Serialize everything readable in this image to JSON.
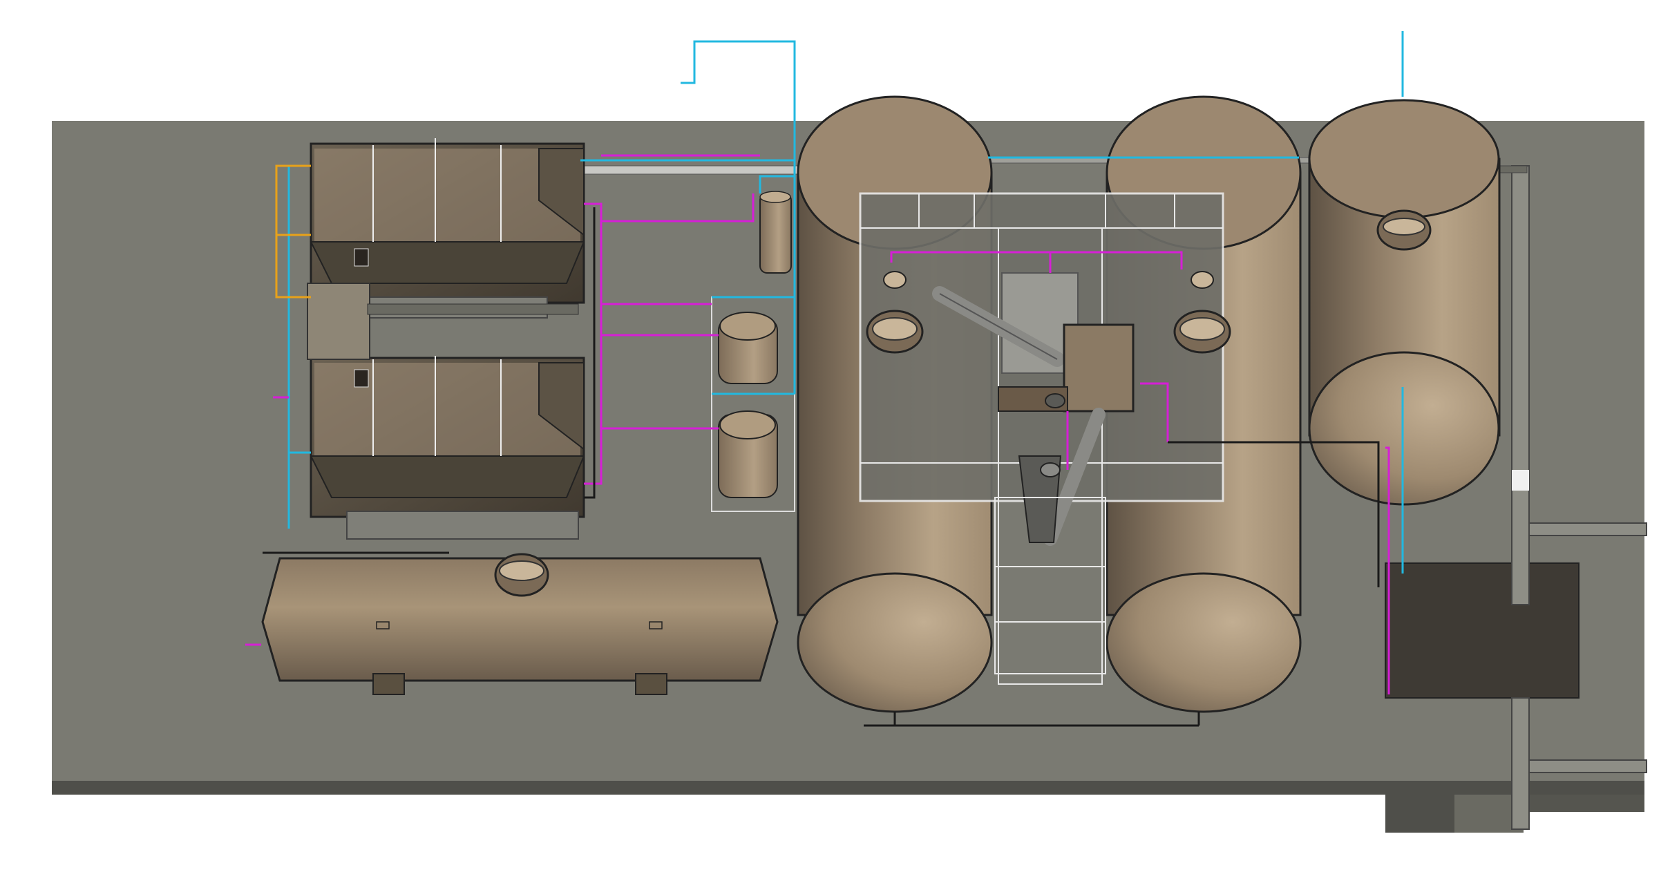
{
  "view": {
    "type": "3D plant layout, top view",
    "labels": []
  },
  "colors": {
    "background": "#ffffff",
    "slab": "#7a7a72",
    "slab_edge": "#4f4f4a",
    "tank_light": "#b8a48a",
    "tank_dark": "#6e6050",
    "basin_dark": "#4a4438",
    "basin_floor": "#a08e78",
    "pipe_water": "#22b8e0",
    "pipe_chem": "#d61fd6",
    "pipe_gas": "#e8a21a",
    "pipe_black": "#1a1a1a",
    "steel_white": "#e8e8e8",
    "equipment_grey": "#8a8a86",
    "dark_pit": "#3e3a34"
  },
  "components": {
    "concrete_slab": "concrete-slab",
    "process_basins": [
      "basin-upper",
      "basin-lower"
    ],
    "horizontal_tank": "horizontal-storage-tank",
    "dosing_tanks": [
      "dosing-tank-1",
      "dosing-tank-2",
      "dosing-tank-3"
    ],
    "vertical_tanks": [
      "vertical-tank-1",
      "vertical-tank-2",
      "vertical-tank-3"
    ],
    "central_platform": "central-access-platform",
    "screw_conveyor": "screw-conveyor",
    "sump": "sump-pit"
  }
}
